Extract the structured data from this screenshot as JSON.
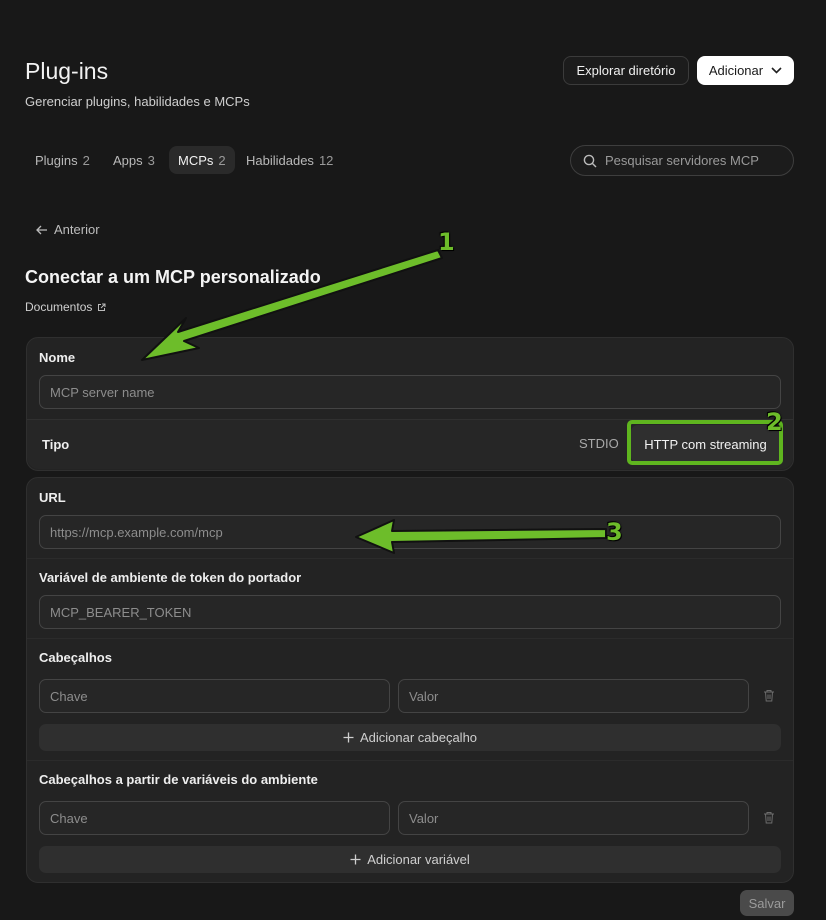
{
  "header": {
    "title": "Plug-ins",
    "subtitle": "Gerenciar plugins, habilidades e MCPs",
    "explore_label": "Explorar diretório",
    "add_label": "Adicionar"
  },
  "tabs": [
    {
      "label": "Plugins",
      "count": "2"
    },
    {
      "label": "Apps",
      "count": "3"
    },
    {
      "label": "MCPs",
      "count": "2"
    },
    {
      "label": "Habilidades",
      "count": "12"
    }
  ],
  "search": {
    "placeholder": "Pesquisar servidores MCP"
  },
  "back_label": "Anterior",
  "section": {
    "title": "Conectar a um MCP personalizado",
    "docs_label": "Documentos"
  },
  "form": {
    "name": {
      "label": "Nome",
      "placeholder": "MCP server name"
    },
    "type": {
      "label": "Tipo",
      "options": [
        "STDIO",
        "HTTP com streaming"
      ],
      "selected": "HTTP com streaming"
    },
    "url": {
      "label": "URL",
      "placeholder": "https://mcp.example.com/mcp"
    },
    "bearer": {
      "label": "Variável de ambiente de token do portador",
      "placeholder": "MCP_BEARER_TOKEN"
    },
    "headers": {
      "label": "Cabeçalhos",
      "key_placeholder": "Chave",
      "value_placeholder": "Valor",
      "add_label": "Adicionar cabeçalho"
    },
    "env_headers": {
      "label": "Cabeçalhos a partir de variáveis do ambiente",
      "key_placeholder": "Chave",
      "value_placeholder": "Valor",
      "add_label": "Adicionar variável"
    }
  },
  "save_label": "Salvar",
  "annotations": [
    "1",
    "2",
    "3"
  ],
  "colors": {
    "annotation_green": "#6dbd2a",
    "background": "#181818"
  }
}
